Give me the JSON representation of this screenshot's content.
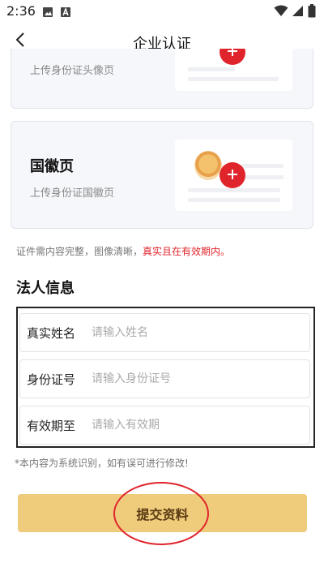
{
  "status_bar": {
    "time": "2:36",
    "icons": [
      "image-icon",
      "a-box-icon",
      "wifi-icon",
      "cellular-icon",
      "battery-icon"
    ]
  },
  "header": {
    "title": "企业认证",
    "back_icon": "chevron-left-icon"
  },
  "id_front_card": {
    "subtitle": "上传身份证头像页"
  },
  "id_emblem_card": {
    "title": "国徽页",
    "subtitle": "上传身份证国徽页"
  },
  "notice": {
    "text": "证件需内容完整，图像清晰，",
    "warning": "真实且在有效期内。"
  },
  "legal_section": {
    "title": "法人信息",
    "fields": [
      {
        "label": "真实姓名",
        "value": "",
        "placeholder": "请输入姓名"
      },
      {
        "label": "身份证号",
        "value": "",
        "placeholder": "请输入身份证号"
      },
      {
        "label": "有效期至",
        "value": "",
        "placeholder": "请输入有效期"
      }
    ]
  },
  "hint": "*本内容为系统识别，如有误可进行修改!",
  "submit_label": "提交资料",
  "colors": {
    "accent_red": "#e0242b",
    "button_gold": "#efcb7c",
    "card_bg": "#f6f7fb"
  }
}
